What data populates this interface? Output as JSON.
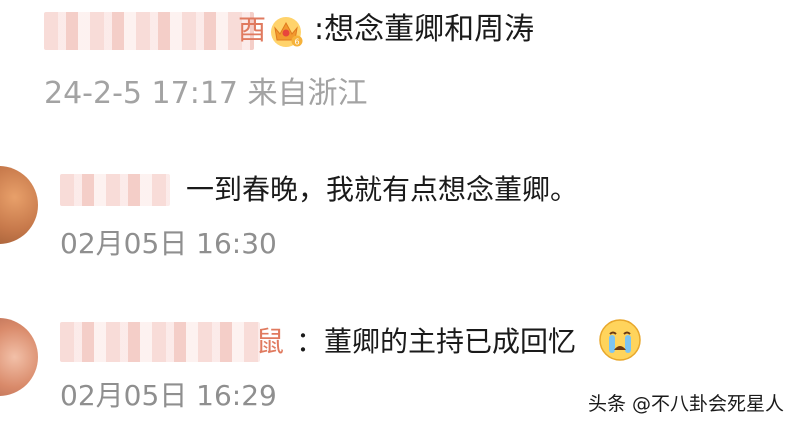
{
  "top_comment": {
    "name_tail": "酉",
    "badge_icon": "vip-crown-icon",
    "text": ":想念董卿和周涛",
    "meta": "24-2-5 17:17 来自浙江"
  },
  "replies": [
    {
      "text": "一到春晚，我就有点想念董卿。",
      "time": "02月05日 16:30"
    },
    {
      "name_tail": "鼠",
      "separator": "：",
      "text": "董卿的主持已成回忆",
      "emoji_icon": "crying-face-icon",
      "time": "02月05日 16:29"
    }
  ],
  "watermark": "头条 @不八卦会死星人"
}
